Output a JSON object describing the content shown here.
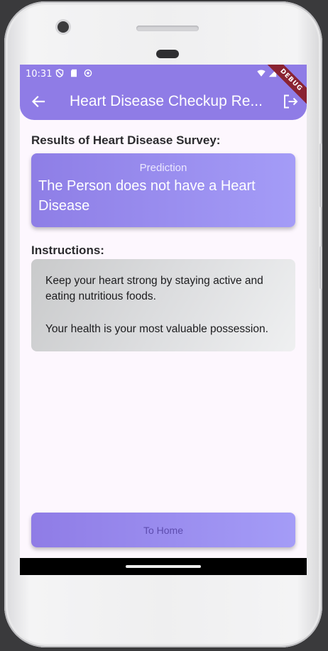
{
  "status_bar": {
    "time": "10:31",
    "left_icons": [
      "shield-icon",
      "sd-card-icon",
      "sync-icon"
    ],
    "right_icons": [
      "wifi-icon",
      "signal-icon",
      "battery-icon"
    ],
    "debug_banner": "DEBUG"
  },
  "app_bar": {
    "title": "Heart Disease Checkup Re...",
    "back_icon": "arrow-back-icon",
    "action_icon": "logout-icon",
    "color": "#8f7ce6"
  },
  "results": {
    "heading": "Results of Heart Disease Survey:",
    "card_label": "Prediction",
    "prediction": "The Person does not have a Heart Disease"
  },
  "instructions": {
    "heading": "Instructions:",
    "lines": [
      "Keep your heart strong by staying active and eating nutritious foods.",
      "Your health is your most valuable possession."
    ]
  },
  "footer": {
    "home_button": "To Home"
  },
  "colors": {
    "accent": "#8f7ce6",
    "accent_light": "#a49cf7",
    "background": "#fdf7fe",
    "button_text": "#5d4cae"
  }
}
